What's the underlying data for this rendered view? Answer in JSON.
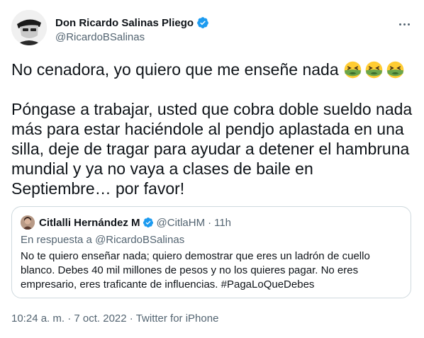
{
  "author": {
    "display_name": "Don Ricardo Salinas Pliego",
    "handle": "@RicardoBSalinas"
  },
  "tweet": {
    "line1": "No cenadora, yo quiero que me enseñe nada",
    "emoji_count": 3,
    "emoji": "nauseated-face",
    "paragraph2": "Póngase a trabajar, usted que cobra doble sueldo nada más para estar haciéndole al pendjo aplastada en una silla, deje de tragar para ayudar a detener el hambruna mundial y ya no vaya a clases de baile en Septiembre… por favor!"
  },
  "quoted": {
    "display_name": "Citlalli Hernández M",
    "handle": "@CitlaHM",
    "separator": "·",
    "time": "11h",
    "reply_prefix": "En respuesta a",
    "reply_to": "@RicardoBSalinas",
    "text": "No te quiero enseñar nada; quiero demostrar que eres un ladrón de cuello blanco. Debes 40 mil millones de pesos y no los quieres pagar. No eres empresario, eres traficante de influencias. #PagaLoQueDebes"
  },
  "meta": {
    "time": "10:24 a. m.",
    "sep": " · ",
    "date": "7 oct. 2022",
    "source": "Twitter for iPhone"
  },
  "colors": {
    "verified": "#1d9bf0",
    "text": "#0f1419",
    "secondary": "#536471",
    "border": "#cfd9de"
  }
}
